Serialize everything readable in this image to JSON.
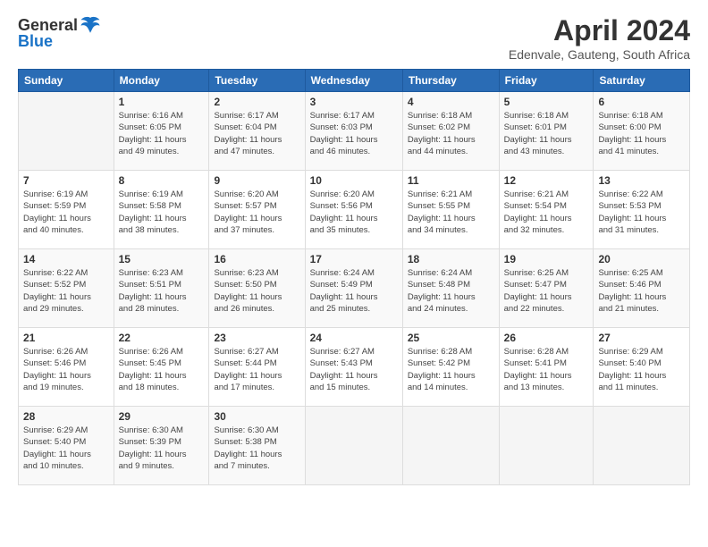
{
  "logo": {
    "general": "General",
    "blue": "Blue"
  },
  "title": "April 2024",
  "subtitle": "Edenvale, Gauteng, South Africa",
  "weekdays": [
    "Sunday",
    "Monday",
    "Tuesday",
    "Wednesday",
    "Thursday",
    "Friday",
    "Saturday"
  ],
  "weeks": [
    [
      {
        "day": "",
        "info": ""
      },
      {
        "day": "1",
        "info": "Sunrise: 6:16 AM\nSunset: 6:05 PM\nDaylight: 11 hours\nand 49 minutes."
      },
      {
        "day": "2",
        "info": "Sunrise: 6:17 AM\nSunset: 6:04 PM\nDaylight: 11 hours\nand 47 minutes."
      },
      {
        "day": "3",
        "info": "Sunrise: 6:17 AM\nSunset: 6:03 PM\nDaylight: 11 hours\nand 46 minutes."
      },
      {
        "day": "4",
        "info": "Sunrise: 6:18 AM\nSunset: 6:02 PM\nDaylight: 11 hours\nand 44 minutes."
      },
      {
        "day": "5",
        "info": "Sunrise: 6:18 AM\nSunset: 6:01 PM\nDaylight: 11 hours\nand 43 minutes."
      },
      {
        "day": "6",
        "info": "Sunrise: 6:18 AM\nSunset: 6:00 PM\nDaylight: 11 hours\nand 41 minutes."
      }
    ],
    [
      {
        "day": "7",
        "info": "Sunrise: 6:19 AM\nSunset: 5:59 PM\nDaylight: 11 hours\nand 40 minutes."
      },
      {
        "day": "8",
        "info": "Sunrise: 6:19 AM\nSunset: 5:58 PM\nDaylight: 11 hours\nand 38 minutes."
      },
      {
        "day": "9",
        "info": "Sunrise: 6:20 AM\nSunset: 5:57 PM\nDaylight: 11 hours\nand 37 minutes."
      },
      {
        "day": "10",
        "info": "Sunrise: 6:20 AM\nSunset: 5:56 PM\nDaylight: 11 hours\nand 35 minutes."
      },
      {
        "day": "11",
        "info": "Sunrise: 6:21 AM\nSunset: 5:55 PM\nDaylight: 11 hours\nand 34 minutes."
      },
      {
        "day": "12",
        "info": "Sunrise: 6:21 AM\nSunset: 5:54 PM\nDaylight: 11 hours\nand 32 minutes."
      },
      {
        "day": "13",
        "info": "Sunrise: 6:22 AM\nSunset: 5:53 PM\nDaylight: 11 hours\nand 31 minutes."
      }
    ],
    [
      {
        "day": "14",
        "info": "Sunrise: 6:22 AM\nSunset: 5:52 PM\nDaylight: 11 hours\nand 29 minutes."
      },
      {
        "day": "15",
        "info": "Sunrise: 6:23 AM\nSunset: 5:51 PM\nDaylight: 11 hours\nand 28 minutes."
      },
      {
        "day": "16",
        "info": "Sunrise: 6:23 AM\nSunset: 5:50 PM\nDaylight: 11 hours\nand 26 minutes."
      },
      {
        "day": "17",
        "info": "Sunrise: 6:24 AM\nSunset: 5:49 PM\nDaylight: 11 hours\nand 25 minutes."
      },
      {
        "day": "18",
        "info": "Sunrise: 6:24 AM\nSunset: 5:48 PM\nDaylight: 11 hours\nand 24 minutes."
      },
      {
        "day": "19",
        "info": "Sunrise: 6:25 AM\nSunset: 5:47 PM\nDaylight: 11 hours\nand 22 minutes."
      },
      {
        "day": "20",
        "info": "Sunrise: 6:25 AM\nSunset: 5:46 PM\nDaylight: 11 hours\nand 21 minutes."
      }
    ],
    [
      {
        "day": "21",
        "info": "Sunrise: 6:26 AM\nSunset: 5:46 PM\nDaylight: 11 hours\nand 19 minutes."
      },
      {
        "day": "22",
        "info": "Sunrise: 6:26 AM\nSunset: 5:45 PM\nDaylight: 11 hours\nand 18 minutes."
      },
      {
        "day": "23",
        "info": "Sunrise: 6:27 AM\nSunset: 5:44 PM\nDaylight: 11 hours\nand 17 minutes."
      },
      {
        "day": "24",
        "info": "Sunrise: 6:27 AM\nSunset: 5:43 PM\nDaylight: 11 hours\nand 15 minutes."
      },
      {
        "day": "25",
        "info": "Sunrise: 6:28 AM\nSunset: 5:42 PM\nDaylight: 11 hours\nand 14 minutes."
      },
      {
        "day": "26",
        "info": "Sunrise: 6:28 AM\nSunset: 5:41 PM\nDaylight: 11 hours\nand 13 minutes."
      },
      {
        "day": "27",
        "info": "Sunrise: 6:29 AM\nSunset: 5:40 PM\nDaylight: 11 hours\nand 11 minutes."
      }
    ],
    [
      {
        "day": "28",
        "info": "Sunrise: 6:29 AM\nSunset: 5:40 PM\nDaylight: 11 hours\nand 10 minutes."
      },
      {
        "day": "29",
        "info": "Sunrise: 6:30 AM\nSunset: 5:39 PM\nDaylight: 11 hours\nand 9 minutes."
      },
      {
        "day": "30",
        "info": "Sunrise: 6:30 AM\nSunset: 5:38 PM\nDaylight: 11 hours\nand 7 minutes."
      },
      {
        "day": "",
        "info": ""
      },
      {
        "day": "",
        "info": ""
      },
      {
        "day": "",
        "info": ""
      },
      {
        "day": "",
        "info": ""
      }
    ]
  ]
}
